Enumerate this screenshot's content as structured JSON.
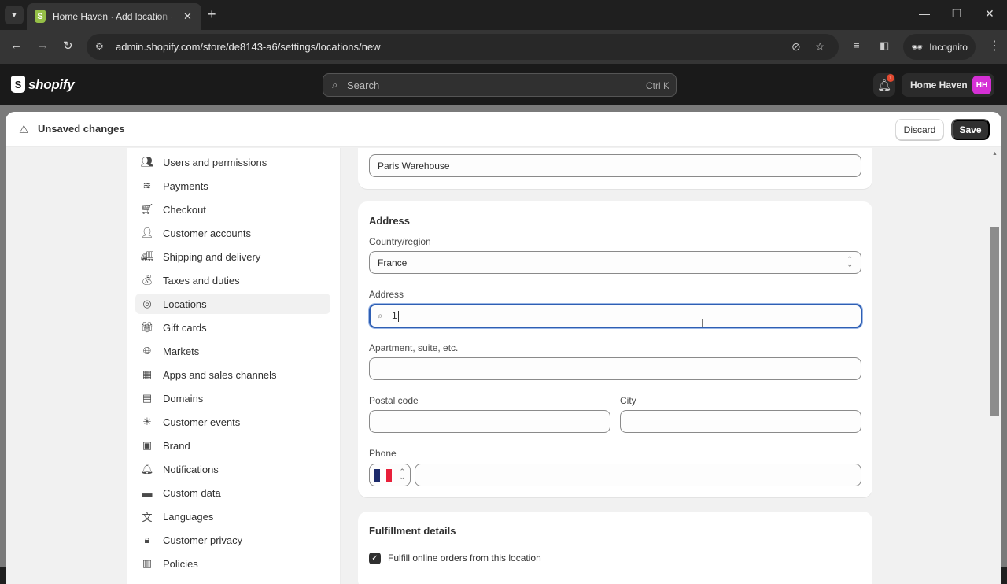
{
  "browser": {
    "tab_title": "Home Haven · Add location · Shopify",
    "url": "admin.shopify.com/store/de8143-a6/settings/locations/new",
    "incognito_label": "Incognito"
  },
  "shopify_bar": {
    "logo_text": "shopify",
    "search_placeholder": "Search",
    "search_shortcut": "Ctrl K",
    "notification_count": "1",
    "store_name": "Home Haven",
    "avatar_initials": "HH",
    "avatar_color": "#d530d5"
  },
  "save_bar": {
    "title": "Unsaved changes",
    "discard_label": "Discard",
    "save_label": "Save"
  },
  "settings_nav": {
    "active": "Locations",
    "items": [
      {
        "label": "Users and permissions",
        "icon": "users-lock-icon"
      },
      {
        "label": "Payments",
        "icon": "payments-icon"
      },
      {
        "label": "Checkout",
        "icon": "cart-icon"
      },
      {
        "label": "Customer accounts",
        "icon": "person-icon"
      },
      {
        "label": "Shipping and delivery",
        "icon": "truck-icon"
      },
      {
        "label": "Taxes and duties",
        "icon": "tax-bag-icon"
      },
      {
        "label": "Locations",
        "icon": "location-pin-icon"
      },
      {
        "label": "Gift cards",
        "icon": "gift-card-icon"
      },
      {
        "label": "Markets",
        "icon": "globe-dollar-icon"
      },
      {
        "label": "Apps and sales channels",
        "icon": "apps-icon"
      },
      {
        "label": "Domains",
        "icon": "domain-icon"
      },
      {
        "label": "Customer events",
        "icon": "cursor-click-icon"
      },
      {
        "label": "Brand",
        "icon": "brand-image-icon"
      },
      {
        "label": "Notifications",
        "icon": "bell-icon"
      },
      {
        "label": "Custom data",
        "icon": "custom-data-icon"
      },
      {
        "label": "Languages",
        "icon": "language-icon"
      },
      {
        "label": "Customer privacy",
        "icon": "lock-icon"
      },
      {
        "label": "Policies",
        "icon": "policies-icon"
      }
    ]
  },
  "form": {
    "location_name_value": "Paris Warehouse",
    "address_section_title": "Address",
    "country_label": "Country/region",
    "country_value": "France",
    "address_label": "Address",
    "address_value": "1",
    "apartment_label": "Apartment, suite, etc.",
    "apartment_value": "",
    "postal_label": "Postal code",
    "postal_value": "",
    "city_label": "City",
    "city_value": "",
    "phone_label": "Phone",
    "phone_value": "",
    "phone_country": "France",
    "fulfillment_title": "Fulfillment details",
    "fulfill_online_label": "Fulfill online orders from this location",
    "fulfill_online_checked": true
  }
}
